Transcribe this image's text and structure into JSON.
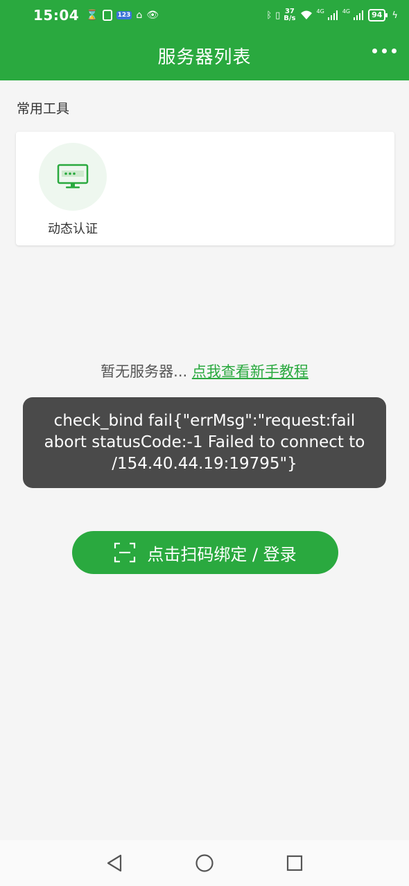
{
  "status_bar": {
    "time": "15:04",
    "net_speed_value": "37",
    "net_speed_unit": "B/s",
    "signal1_label": "4G",
    "signal2_label": "4G",
    "battery": "94",
    "left_icons": [
      "hourglass-icon",
      "clipboard-icon",
      "keypad-123-icon",
      "vpn-icon",
      "eye-icon"
    ],
    "right_icons": [
      "bluetooth-icon",
      "vibrate-icon",
      "wifi-icon",
      "signal-icon",
      "signal-icon",
      "charging-icon"
    ]
  },
  "header": {
    "title": "服务器列表"
  },
  "tools": {
    "section_title": "常用工具",
    "items": [
      {
        "label": "动态认证",
        "icon": "monitor-password-icon"
      }
    ]
  },
  "empty_state": {
    "text": "暂无服务器... ",
    "link": "点我查看新手教程"
  },
  "toast": {
    "message": "check_bind fail{\"errMsg\":\"request:fail abort statusCode:-1 Failed to connect to /154.40.44.19:19795\"}"
  },
  "scan_button": {
    "label": "点击扫码绑定 / 登录",
    "icon": "scan-icon"
  },
  "nav": {
    "items": [
      "back-icon",
      "home-icon",
      "recents-icon"
    ]
  },
  "colors": {
    "primary": "#2aa93f",
    "background": "#f5f5f5",
    "toast_bg": "#4a4a4a"
  }
}
